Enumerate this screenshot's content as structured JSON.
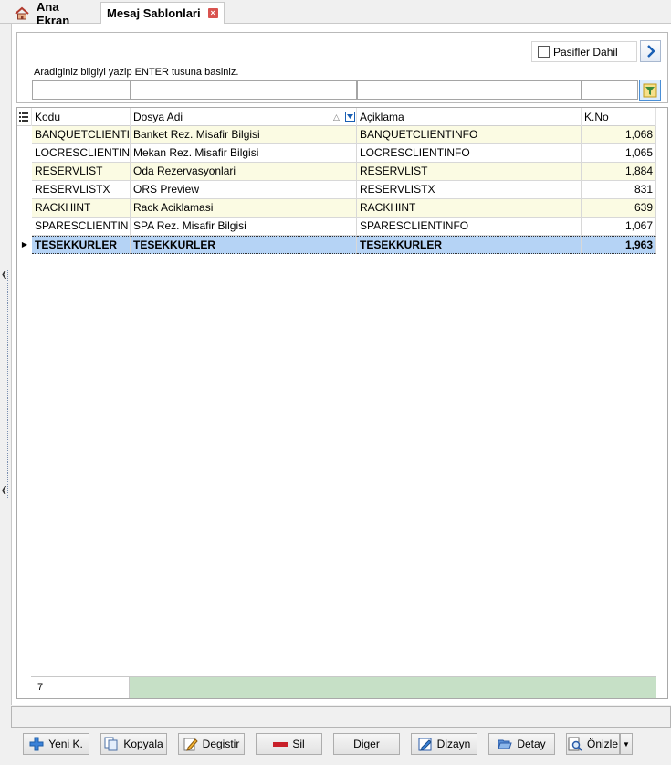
{
  "tabs": [
    {
      "label": "Ana Ekran"
    },
    {
      "label": "Mesaj Sablonlari"
    }
  ],
  "filter": {
    "pasif_label": "Pasifler Dahil",
    "pasif_checked": false,
    "hint": "Aradiginiz bilgiyi yazip ENTER tusuna basiniz.",
    "fields": [
      "",
      "",
      "",
      ""
    ]
  },
  "grid": {
    "columns": [
      "Kodu",
      "Dosya Adi",
      "Açiklama",
      "K.No"
    ],
    "rows": [
      {
        "kodu": "BANQUETCLIENTI",
        "dosya": "Banket Rez. Misafir Bilgisi",
        "aciklama": "BANQUETCLIENTINFO",
        "kno": "1,068"
      },
      {
        "kodu": "LOCRESCLIENTIN",
        "dosya": "Mekan Rez. Misafir Bilgisi",
        "aciklama": "LOCRESCLIENTINFO",
        "kno": "1,065"
      },
      {
        "kodu": "RESERVLIST",
        "dosya": "Oda Rezervasyonlari",
        "aciklama": "RESERVLIST",
        "kno": "1,884"
      },
      {
        "kodu": "RESERVLISTX",
        "dosya": "ORS Preview",
        "aciklama": "RESERVLISTX",
        "kno": "831"
      },
      {
        "kodu": "RACKHINT",
        "dosya": "Rack Aciklamasi",
        "aciklama": "RACKHINT",
        "kno": "639"
      },
      {
        "kodu": "SPARESCLIENTIN",
        "dosya": "SPA Rez. Misafir Bilgisi",
        "aciklama": "SPARESCLIENTINFO",
        "kno": "1,067"
      },
      {
        "kodu": "TESEKKURLER",
        "dosya": "TESEKKURLER",
        "aciklama": "TESEKKURLER",
        "kno": "1,963"
      }
    ],
    "footer_count": "7"
  },
  "toolbar": {
    "yeni": "Yeni K.",
    "kopyala": "Kopyala",
    "degistir": "Degistir",
    "sil": "Sil",
    "diger": "Diger",
    "dizayn": "Dizayn",
    "detay": "Detay",
    "onizle": "Önizle"
  },
  "colors": {
    "alt_row": "#fbfbe3",
    "selected_row": "#b5d3f5",
    "footer_bar": "#c6e0c6",
    "tab_close": "#d9534f"
  }
}
